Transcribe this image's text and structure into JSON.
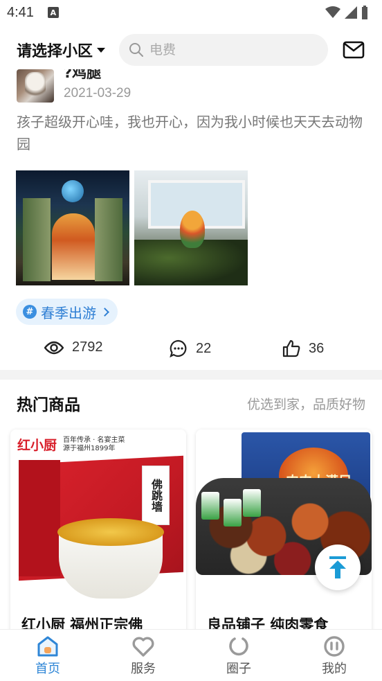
{
  "status_bar": {
    "time": "4:41",
    "notif_icon": "A"
  },
  "header": {
    "region_label": "请选择小区",
    "search_placeholder": "电费"
  },
  "post": {
    "user_name": "?鸡腿",
    "date": "2021-03-29",
    "text": "孩子超级开心哇，我也开心，因为我小时候也天天去动物园",
    "topic": "春季出游",
    "views": "2792",
    "comments": "22",
    "likes": "36"
  },
  "hot_goods": {
    "title": "热门商品",
    "subtitle": "优选到家，品质好物",
    "products": [
      {
        "title": "红小厨 福州正宗佛",
        "brand": "红小厨",
        "tagline_1": "百年传承 · 名宴主菜",
        "tagline_2": "源于福州1899年",
        "package_text": "佛跳墙"
      },
      {
        "title": "良品铺子 纯肉零食",
        "package_text": "肉肉大满足"
      }
    ]
  },
  "bottom_nav": {
    "items": [
      {
        "label": "首页",
        "active": true
      },
      {
        "label": "服务",
        "active": false
      },
      {
        "label": "圈子",
        "active": false
      },
      {
        "label": "我的",
        "active": false
      }
    ]
  },
  "colors": {
    "accent": "#2f86d6",
    "topic_bg": "#e6f2fd",
    "home_icon_fill": "#f5a45a"
  }
}
